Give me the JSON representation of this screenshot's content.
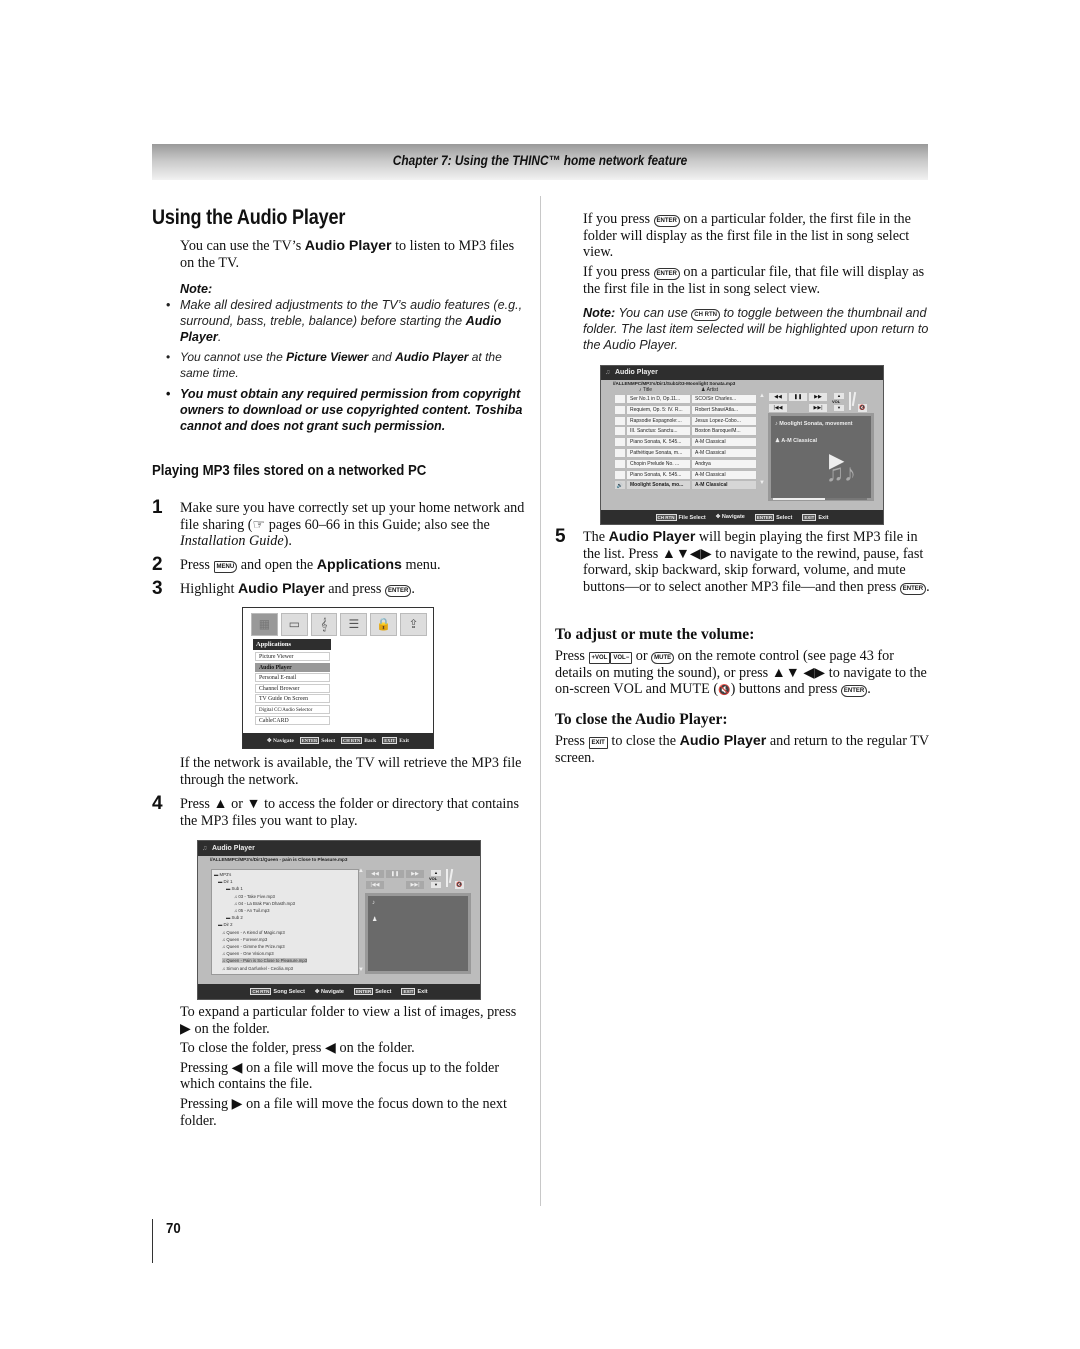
{
  "header": {
    "chapter": "Chapter 7: Using the THINC™ home network feature"
  },
  "left": {
    "title": "Using the Audio Player",
    "intro": {
      "pre": "You can use the TV’s ",
      "bold": "Audio Player",
      "post": " to listen to MP3 files on the TV."
    },
    "note_label": "Note:",
    "notes": [
      {
        "text": "Make all desired adjustments to the TV’s audio features (e.g., surround, bass, treble, balance) before starting the ",
        "bold": "Audio Player",
        "post": "."
      },
      {
        "pre": "You cannot use the ",
        "bold1": "Picture Viewer",
        "mid": " and ",
        "bold2": "Audio Player",
        "post": " at the same time."
      },
      {
        "text": "You must obtain any required permission from copyright owners to download or use copyrighted content. Toshiba cannot and does not grant such permission."
      }
    ],
    "section_title": "Playing MP3 files stored on a networked PC",
    "steps": [
      {
        "num": "1",
        "pre": "Make sure you have correctly set up your home network and file sharing (",
        "icon": "☞",
        "mid": " pages 60–66 in this Guide; also see the ",
        "ital": "Installation Guide",
        "post": ")."
      },
      {
        "num": "2",
        "pre": "Press ",
        "key": "MENU",
        "mid": " and open the ",
        "bold": "Applications",
        "post": " menu."
      },
      {
        "num": "3",
        "pre": "Highlight ",
        "bold": "Audio Player",
        "mid": " and press ",
        "key": "ENTER",
        "post": "."
      }
    ],
    "after_menu": "If the network is available, the TV will retrieve the MP3 file through the network.",
    "step4": {
      "num": "4",
      "pre": "Press ",
      "up": "▲",
      "or": " or ",
      "down": "▼",
      "post": " to access the folder or directory that contains the MP3 files you want to play."
    },
    "folder_notes": [
      {
        "pre": "To expand a particular folder to view a list of images, press ",
        "arrow": "▶",
        "post": " on the folder."
      },
      {
        "pre": "To close the folder, press ",
        "arrow": "◀",
        "post": " on the folder."
      },
      {
        "pre": "Pressing ",
        "arrow": "◀",
        "post": " on a file will move the focus up to the folder which contains the file."
      },
      {
        "pre": "Pressing ",
        "arrow": "▶",
        "post": " on a file will move the focus down to the next folder."
      }
    ],
    "page_number": "70"
  },
  "apps_menu": {
    "header": "Applications",
    "items": [
      "Picture Viewer",
      "Audio Player",
      "Personal E-mail",
      "Channel Browser",
      "TV Guide On Screen",
      "Digital CC/Audio Selector",
      "CableCARD"
    ],
    "selected": "Audio Player",
    "footer": {
      "navigate": "Navigate",
      "enter_key": "ENTER",
      "select": "Select",
      "back_key": "CH RTN",
      "back": "Back",
      "exit_key": "EXIT",
      "exit": "Exit"
    }
  },
  "folder_screen": {
    "title": "Audio Player",
    "path": "//ALLENMPC/MP3's/Dir1/Queen - pain is Close to Pleasure.mp3",
    "tree": [
      {
        "label": "MP3's",
        "type": "folder"
      },
      {
        "label": "Dir 1",
        "type": "folder"
      },
      {
        "label": "Sub 1",
        "type": "folder"
      },
      {
        "label": "03 - Take Five.mp3",
        "type": "file"
      },
      {
        "label": "04 - La Brak Pan Dhasth.mp3",
        "type": "file"
      },
      {
        "label": "05 - An Tuil.mp3",
        "type": "file"
      },
      {
        "label": "Sub 2",
        "type": "folder"
      },
      {
        "label": "Dir 2",
        "type": "folder"
      },
      {
        "label": "Queen - A Kiend of Magic.mp3",
        "type": "file"
      },
      {
        "label": "Queen - Forever.mp3",
        "type": "file"
      },
      {
        "label": "Queen - Gimme the Prize.mp3",
        "type": "file"
      },
      {
        "label": "Queen - One Vision.mp3",
        "type": "file"
      },
      {
        "label": "Queen - Pain is So Close to Pleasure.mp3",
        "type": "file",
        "selected": true
      },
      {
        "label": "Simon and Garfunkel - Cecilia.mp3",
        "type": "file"
      }
    ],
    "vol_label": "VOL",
    "footer": {
      "chrtn_key": "CH RTN",
      "song_select": "Song Select",
      "navigate": "Navigate",
      "enter_key": "ENTER",
      "select": "Select",
      "exit_key": "EXIT",
      "exit": "Exit"
    }
  },
  "right": {
    "p1": {
      "pre": "If you press ",
      "key": "ENTER",
      "post": " on a particular folder, the first file in the folder will display as the first file in the list in song select view."
    },
    "p2": {
      "pre": "If you press ",
      "key": "ENTER",
      "post": " on a particular file, that file will display as the first file in the list in song select view."
    },
    "note": {
      "label": "Note:",
      "pre": " You can use ",
      "key": "CH RTN",
      "post": " to toggle between the thumbnail and folder. The last item selected will be highlighted upon return to the Audio Player."
    },
    "step5": {
      "num": "5",
      "pre": "The ",
      "bold": "Audio Player",
      "mid": " will begin playing the first MP3 file in the list. Press ",
      "arrows": "▲▼◀▶",
      "post": " to navigate to the rewind, pause, fast forward, skip backward, skip forward, volume, and mute buttons—or to select another MP3 file—and then press ",
      "key": "ENTER",
      "end": "."
    },
    "vol_heading": "To adjust or mute the volume:",
    "vol_text": {
      "pre": "Press ",
      "k1": "+VOL",
      "k2": "VOL−",
      "or": " or ",
      "k3": "MUTE",
      "mid": " on the remote control (see page 43 for details on muting the sound), or press ",
      "arrows1": "▲▼",
      "arrows2": "◀▶",
      "mid2": " to navigate to the on-screen VOL and MUTE (",
      "mute": "🔇",
      "post": ") buttons and press ",
      "key": "ENTER",
      "end": "."
    },
    "close_heading": "To close the Audio Player:",
    "close_text": {
      "pre": "Press ",
      "key": "EXIT",
      "mid": " to close the ",
      "bold": "Audio Player",
      "post": " and return to the regular TV screen."
    }
  },
  "song_screen": {
    "title": "Audio Player",
    "path": "//ALLENMPC/MP3's/Dir1/Sub1/03-Moonlight Sonata.mp3",
    "col_title": "Title",
    "col_artist": "Artist",
    "rows": [
      {
        "title": "Ser No.1 in D, Op.11...",
        "artist": "SCO/Sir Charles..."
      },
      {
        "title": "Requiem, Op. 5: IV. R...",
        "artist": "Robert Shaw/Atla..."
      },
      {
        "title": "Rapsodie Espagnole:...",
        "artist": "Jesus Lopez-Cobo..."
      },
      {
        "title": "III. Sanctus: Sanctu...",
        "artist": "Boston Baroque/M..."
      },
      {
        "title": "Piano Sonata, K. 545...",
        "artist": "A-M Classical"
      },
      {
        "title": "Pathétique Sonata, m...",
        "artist": "A-M Classical"
      },
      {
        "title": "Chopin Prelude No. ...",
        "artist": "Andrya"
      },
      {
        "title": "Piano Sonata, K. 545...",
        "artist": "A-M Classical"
      },
      {
        "title": "Moolight Sonata, mo...",
        "artist": "A-M Classical",
        "playing": true
      }
    ],
    "now_playing_title": "Moolight Sonata, movement",
    "now_playing_artist": "A-M Classical",
    "progress": 0.55,
    "vol_label": "VOL",
    "footer": {
      "chrtn_key": "CH RTN",
      "file_select": "File Select",
      "navigate": "Navigate",
      "enter_key": "ENTER",
      "select": "Select",
      "exit_key": "EXIT",
      "exit": "Exit"
    }
  }
}
